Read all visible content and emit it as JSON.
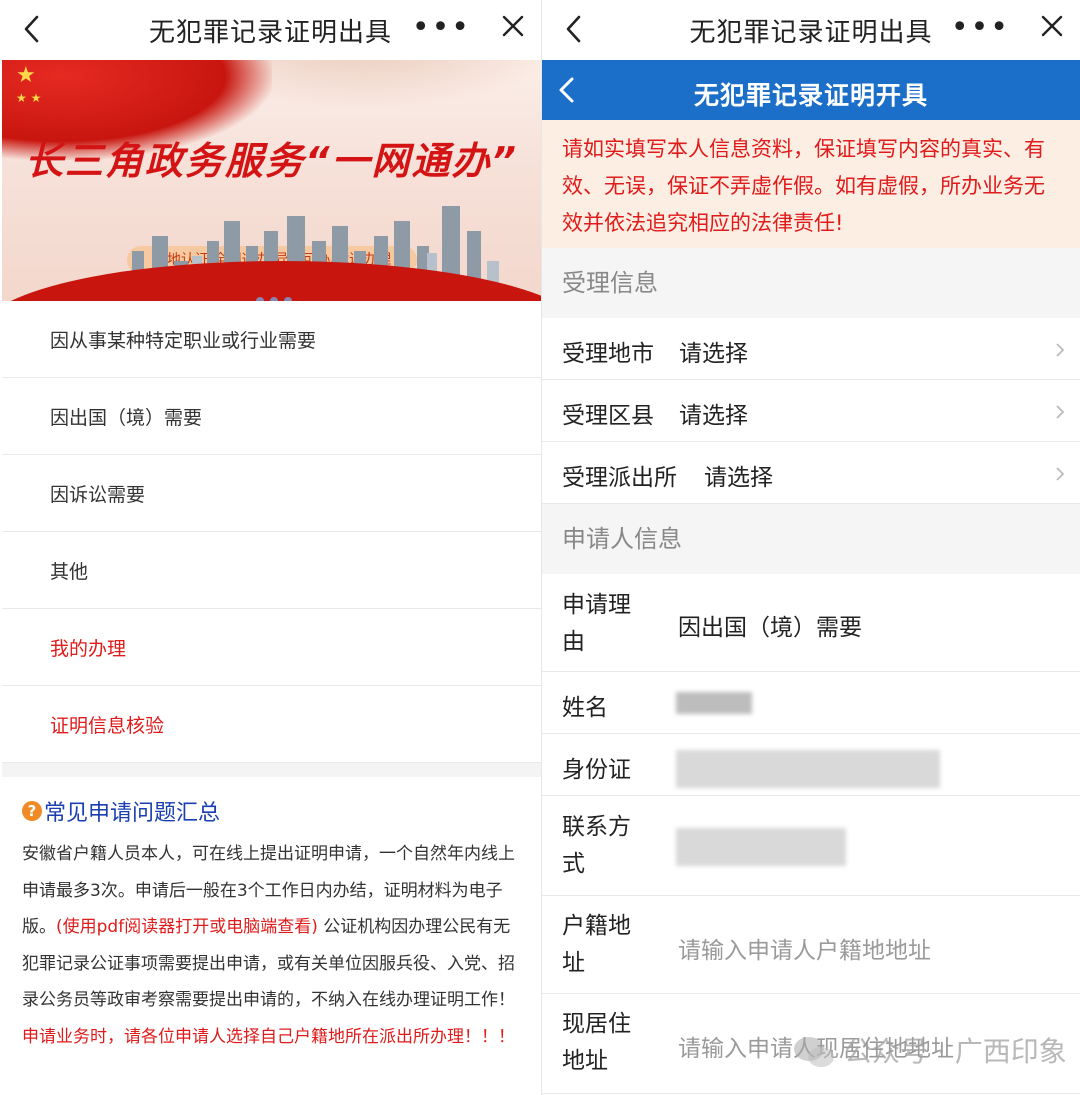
{
  "left": {
    "topbar": {
      "title": "无犯罪记录证明出具",
      "more": "•••"
    },
    "banner": {
      "headline": "长三角政务服务“一网通办”",
      "tagline": "一地认证/全网通办/异地可办/就近办理"
    },
    "menu": [
      {
        "label": "因从事某种特定职业或行业需要",
        "color": "#333333"
      },
      {
        "label": "因出国（境）需要",
        "color": "#333333"
      },
      {
        "label": "因诉讼需要",
        "color": "#333333"
      },
      {
        "label": "其他",
        "color": "#333333"
      },
      {
        "label": "我的办理",
        "color": "#e01b1b"
      },
      {
        "label": "证明信息核验",
        "color": "#e01b1b"
      }
    ],
    "faq": {
      "icon": "question-circle-icon",
      "title": "常见申请问题汇总",
      "text_1": "安徽省户籍人员本人，可在线上提出证明申请，一个自然年内线上申请最多3次。申请后一般在3个工作日内办结，证明材料为电子版。",
      "text_red_1": "(使用pdf阅读器打开或电脑端查看)",
      "text_2": " 公证机构因办理公民有无犯罪记录公证事项需要提出申请，或有关单位因服兵役、入党、招录公务员等政审考察需要提出申请的，不纳入在线办理证明工作！ ",
      "text_red_2": "申请业务时，请各位申请人选择自己户籍地所在派出所办理！！！"
    }
  },
  "right": {
    "topbar": {
      "title": "无犯罪记录证明出具",
      "more": "•••"
    },
    "header": {
      "title": "无犯罪记录证明开具"
    },
    "notice": "请如实填写本人信息资料，保证填写内容的真实、有效、无误，保证不弄虚作假。如有虚假，所办业务无效并依法追究相应的法律责任!",
    "section_accept": "受理信息",
    "accept_rows": [
      {
        "label": "受理地市",
        "value": "请选择"
      },
      {
        "label": "受理区县",
        "value": "请选择"
      },
      {
        "label": "受理派出所",
        "value": "请选择"
      }
    ],
    "section_applicant": "申请人信息",
    "reason": {
      "label_1": "申请理",
      "label_2": "由",
      "value": "因出国（境）需要"
    },
    "name": {
      "label": "姓名"
    },
    "id_card": {
      "label": "身份证"
    },
    "contact": {
      "label_1": "联系方",
      "label_2": "式"
    },
    "household": {
      "label_1": "户籍地",
      "label_2": "址",
      "placeholder": "请输入申请人户籍地地址"
    },
    "residence": {
      "label_1": "现居住",
      "label_2": "地址",
      "placeholder": "请输入申请人现居住地地址"
    }
  },
  "watermark": "公众号 · 广西印象",
  "colors": {
    "brand_blue": "#1c6fc8",
    "alert_red": "#e01b1b",
    "notice_bg": "#fdeee3",
    "link_blue": "#1a3fb0"
  }
}
